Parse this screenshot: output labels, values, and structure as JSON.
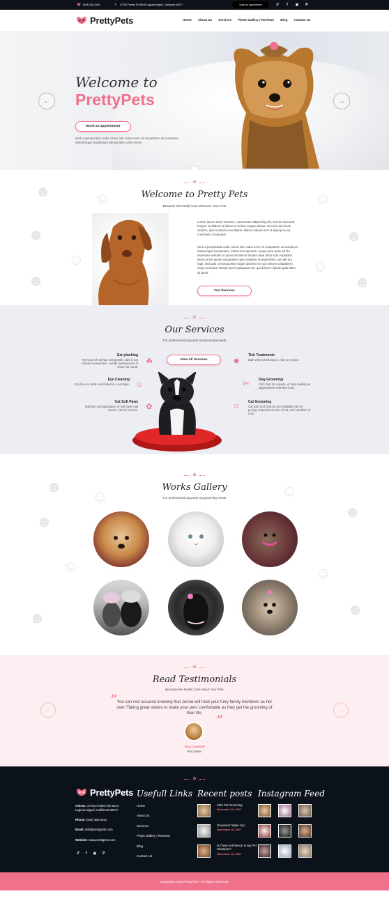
{
  "colors": {
    "accent": "#f0718a",
    "dark": "#0c1219",
    "services_bg": "#eceef3",
    "testimonial_bg": "#fdeff1"
  },
  "topbar": {
    "phone": "(949) 382-0441",
    "address": "27762 Forbes Rd Ste B Laguna Niguel, California 92677",
    "book_button": "Book an appointment",
    "social_icons": [
      "twitter-icon",
      "facebook-icon",
      "instagram-icon",
      "pinterest-icon"
    ]
  },
  "header": {
    "logo_text": "PrettyPets",
    "nav": [
      "Home",
      "About Us",
      "Services",
      "Photo Gallery / Reviews",
      "Blog",
      "Contact Us"
    ]
  },
  "hero": {
    "welcome": "Welcome to",
    "brand": "PrettyPets",
    "description": "Sed ut perspiciatis unde omnis iste natus error sit voluptatem accusantium doloremque laudantium perspiciatis unde omnis",
    "cta": "Book an appointment"
  },
  "about": {
    "title": "Welcome to Pretty Pets",
    "subtitle": "Because We Really Care Welcome Your Pets",
    "paragraph1": "Lorem ipsum dolor sit amet, consectetur adipiscing elit, sed do eiusmod tempor incididunt ut labore et dolore magna aliqua. Ut enim ad minim veniam, quis nostrud exercitation ullamco laboris nisi ut aliquip ex ea commodo consequat.",
    "paragraph2": "Sed ut perspiciatis unde omnis iste natus error sit voluptatem accusantium doloremque laudantium, totam rem aperiam, eaque ipsa quae ab illo inventore veritatis et quasi architecto beatae vitae dicta sunt explicabo. Nemo enim ipsam voluptatem quia voluptas sit aspernatur aut odit aut fugit, sed quia consequuntur magni dolores eos qui ratione voluptatem sequi nesciunt. Neque porro quisquam est, qui dolorem ipsum quia dolor sit amet",
    "button": "Our Services"
  },
  "services": {
    "title": "Our Services",
    "subtitle": "For professional dog and cat grooming needs",
    "view_all": "View All Services",
    "items": [
      {
        "title": "Ear plucking",
        "text": "Removal of ear hair overgrowth, aids in ear infection prevention, overall maintenance of clean ear canal.",
        "icon": "dog-ear-icon"
      },
      {
        "title": "Eye Cleaning",
        "text": "Can be a la carte or included in a package.",
        "icon": "cat-face-icon"
      },
      {
        "title": "Cat Soft Paws",
        "text": "Nail trim and application of soft paws nail covers. Add on service.",
        "icon": "paw-nail-icon"
      },
      {
        "title": "Tick Treatments",
        "text": "Bath with tick shampoo. Add on service",
        "icon": "tick-icon"
      },
      {
        "title": "Dog Grooming",
        "text": "Call / text for a quote, or help making an appointment! 949-382-0441",
        "icon": "dog-grooming-icon"
      },
      {
        "title": "Cat Grooming",
        "text": "Cat bath and haircuts are available call for pricing. Depends on size of cat, and condition of coat.",
        "icon": "cat-grooming-icon"
      }
    ]
  },
  "gallery": {
    "title": "Works Gallery",
    "subtitle": "For professional dog and cat grooming needs"
  },
  "testimonials": {
    "title": "Read Testimonials",
    "subtitle": "Because We Really Care About Your Pets",
    "quote": "You can rest assured knowing that Jenna will treat your furry family members as her own! Taking great strides to make your pets comfortable as they get the grooming of their life.",
    "author": "Tina Cambell",
    "role": "Pet Owner"
  },
  "footer": {
    "logo_text": "PrettyPets",
    "address_label": "Adress:",
    "address": "27762 Forbes Rd Ste B Laguna Niguel, California 92677",
    "phone_label": "Phone:",
    "phone": "(949) 382-0441",
    "email_label": "Email:",
    "email": "info@prettypets.com",
    "website_label": "Website:",
    "website": "www.prettypets.com",
    "links_title": "Usefull Links",
    "links": [
      "Home",
      "About Us",
      "Services",
      "Photo Gallery / Reviews",
      "Blog",
      "Contact Us"
    ],
    "posts_title": "Recent posts",
    "posts": [
      {
        "title": "Safe Pet Grooming",
        "date": "November 16, 2017"
      },
      {
        "title": "Groomers' Wake Up!",
        "date": "November 16, 2017"
      },
      {
        "title": "Is There Anti-freeze In My Pet Shampoo?",
        "date": "November 16, 2017"
      }
    ],
    "instagram_title": "Instagram Feed",
    "copyright": "Copyrights 2020 PrettyPets • All Rights Reserved."
  }
}
